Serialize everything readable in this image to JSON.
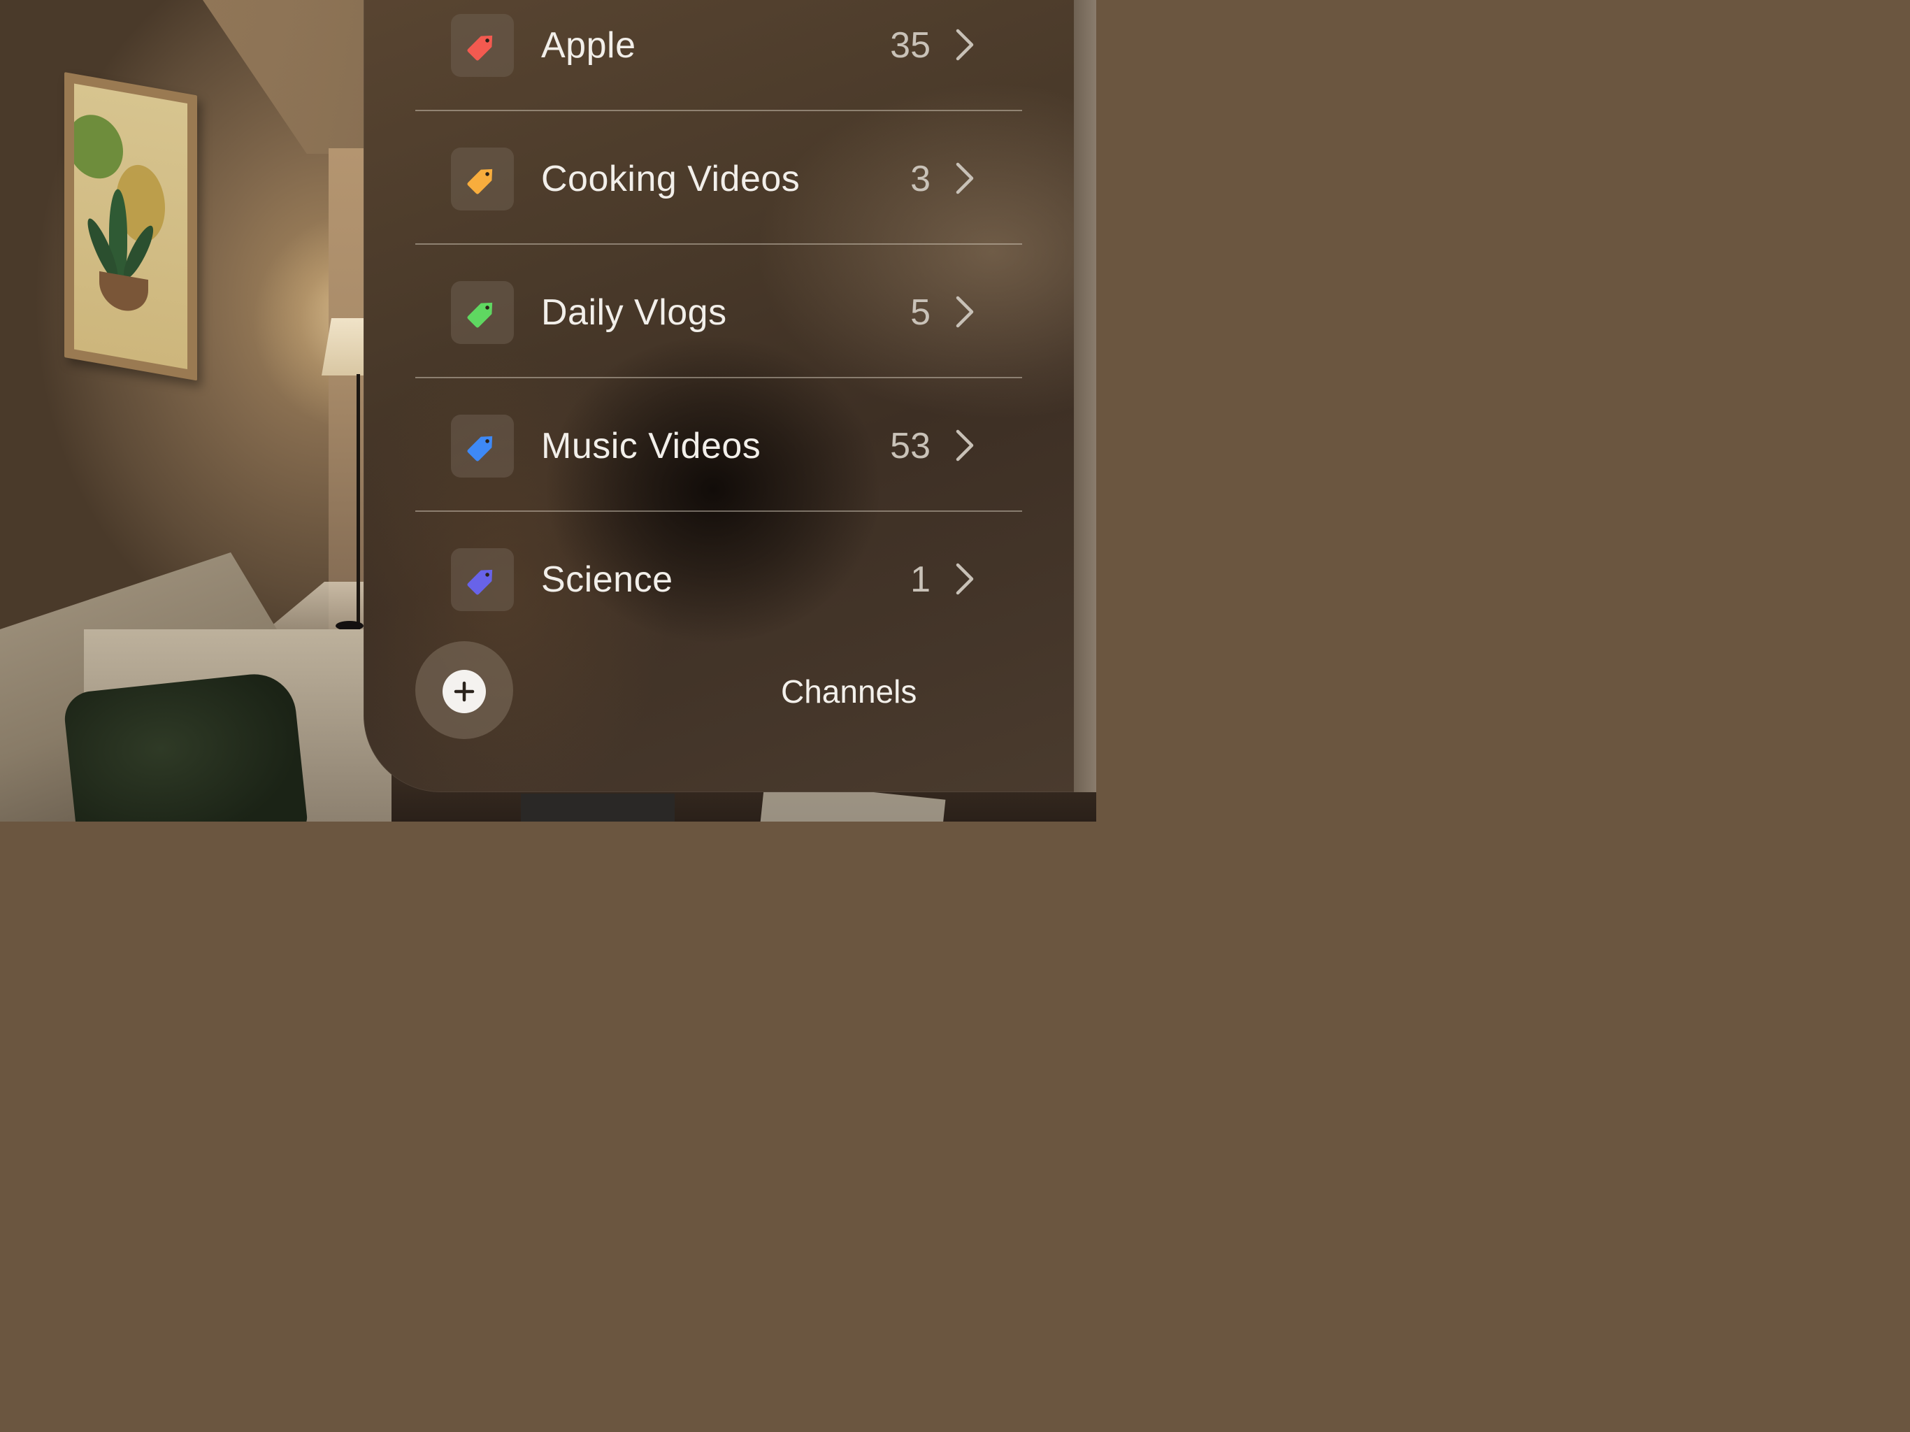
{
  "list": {
    "items": [
      {
        "label": "Apple",
        "count": "35",
        "tag_color": "#f35a50",
        "icon": "tag-icon"
      },
      {
        "label": "Cooking Videos",
        "count": "3",
        "tag_color": "#f8ad3d",
        "icon": "tag-icon"
      },
      {
        "label": "Daily Vlogs",
        "count": "5",
        "tag_color": "#5fd761",
        "icon": "tag-icon"
      },
      {
        "label": "Music Videos",
        "count": "53",
        "tag_color": "#3e89f6",
        "icon": "tag-icon"
      },
      {
        "label": "Science",
        "count": "1",
        "tag_color": "#6863e9",
        "icon": "tag-icon"
      }
    ]
  },
  "footer": {
    "title": "Channels",
    "add_icon": "plus-icon"
  }
}
